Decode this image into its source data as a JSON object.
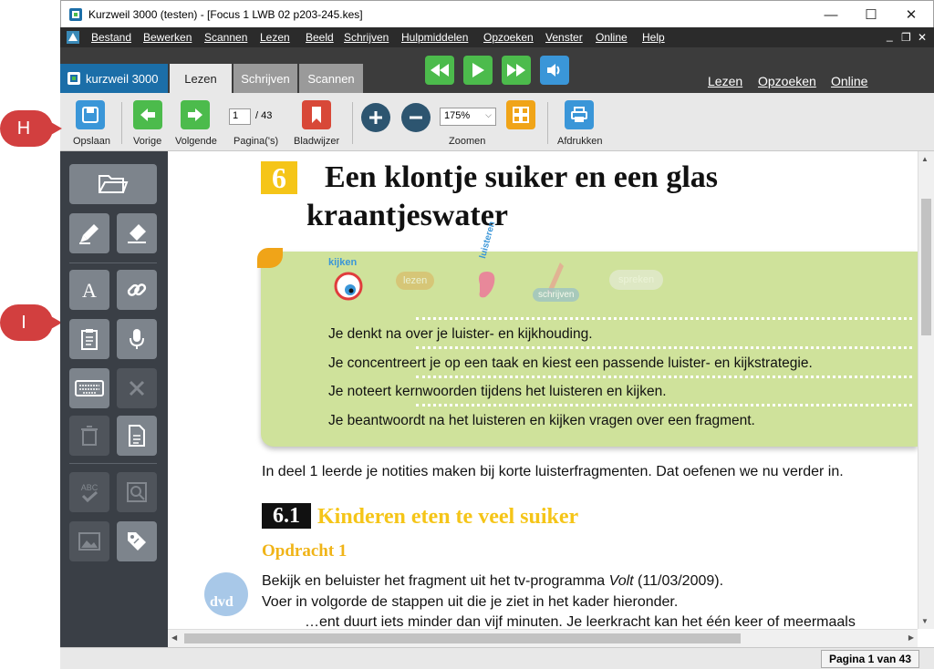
{
  "window": {
    "title": "Kurzweil 3000 (testen) - [Focus 1 LWB 02 p203-245.kes]",
    "minimize": "—",
    "maximize": "☐",
    "close": "✕"
  },
  "menu": [
    "Bestand",
    "Bewerken",
    "Scannen",
    "Lezen",
    "Beeld",
    "Schrijven",
    "Hulpmiddelen",
    "Opzoeken",
    "Venster",
    "Online",
    "Help"
  ],
  "menu_controls": [
    "_",
    "❐",
    "✕"
  ],
  "brand": "kurzweil 3000",
  "tabs": [
    "Lezen",
    "Schrijven",
    "Scannen"
  ],
  "right_links": [
    "Lezen",
    "Opzoeken",
    "Online"
  ],
  "toolbar": {
    "save": "Opslaan",
    "prev": "Vorige",
    "next": "Volgende",
    "page_value": "1",
    "page_total": "/ 43",
    "pages_label": "Pagina('s)",
    "bookmark": "Bladwijzer",
    "zoom_value": "175%",
    "zoom_label": "Zoomen",
    "print": "Afdrukken"
  },
  "callouts": [
    "H",
    "I"
  ],
  "document": {
    "chapter_num": "6",
    "title_line1": "Een klontje suiker en een glas",
    "title_line2": "kraantjeswater",
    "skills": [
      "kijken",
      "lezen",
      "luisteren",
      "schrijven",
      "spreken"
    ],
    "goals": [
      "Je denkt na over je luister- en kijkhouding.",
      "Je concentreert je op een taak en kiest een passende luister- en kijkstrategie.",
      "Je noteert kernwoorden tijdens het luisteren en kijken.",
      "Je beantwoordt na het luisteren en kijken vragen over een fragment."
    ],
    "intro": "In deel 1 leerde je notities maken bij korte luisterfragmenten. Dat oefenen we nu verder in.",
    "section_num": "6.1",
    "section_title": "Kinderen eten te veel suiker",
    "exercise": "Opdracht 1",
    "dvd": "dvd",
    "body1_pre": "Bekijk en beluister het fragment uit het tv-programma ",
    "body1_em": "Volt",
    "body1_post": " (11/03/2009).",
    "body2": "Voer in volgorde de stappen uit die je ziet in het kader hieronder.",
    "body3": "…ent duurt iets minder dan vijf minuten. Je leerkracht kan het één keer of meermaals"
  },
  "status": "Pagina 1 van 43",
  "colors": {
    "accent": "#1b6ea8",
    "play_green": "#4cbb4c",
    "goal_box": "#cfe29b",
    "section_yellow": "#f5c518",
    "badge_red": "#d23f3f"
  }
}
